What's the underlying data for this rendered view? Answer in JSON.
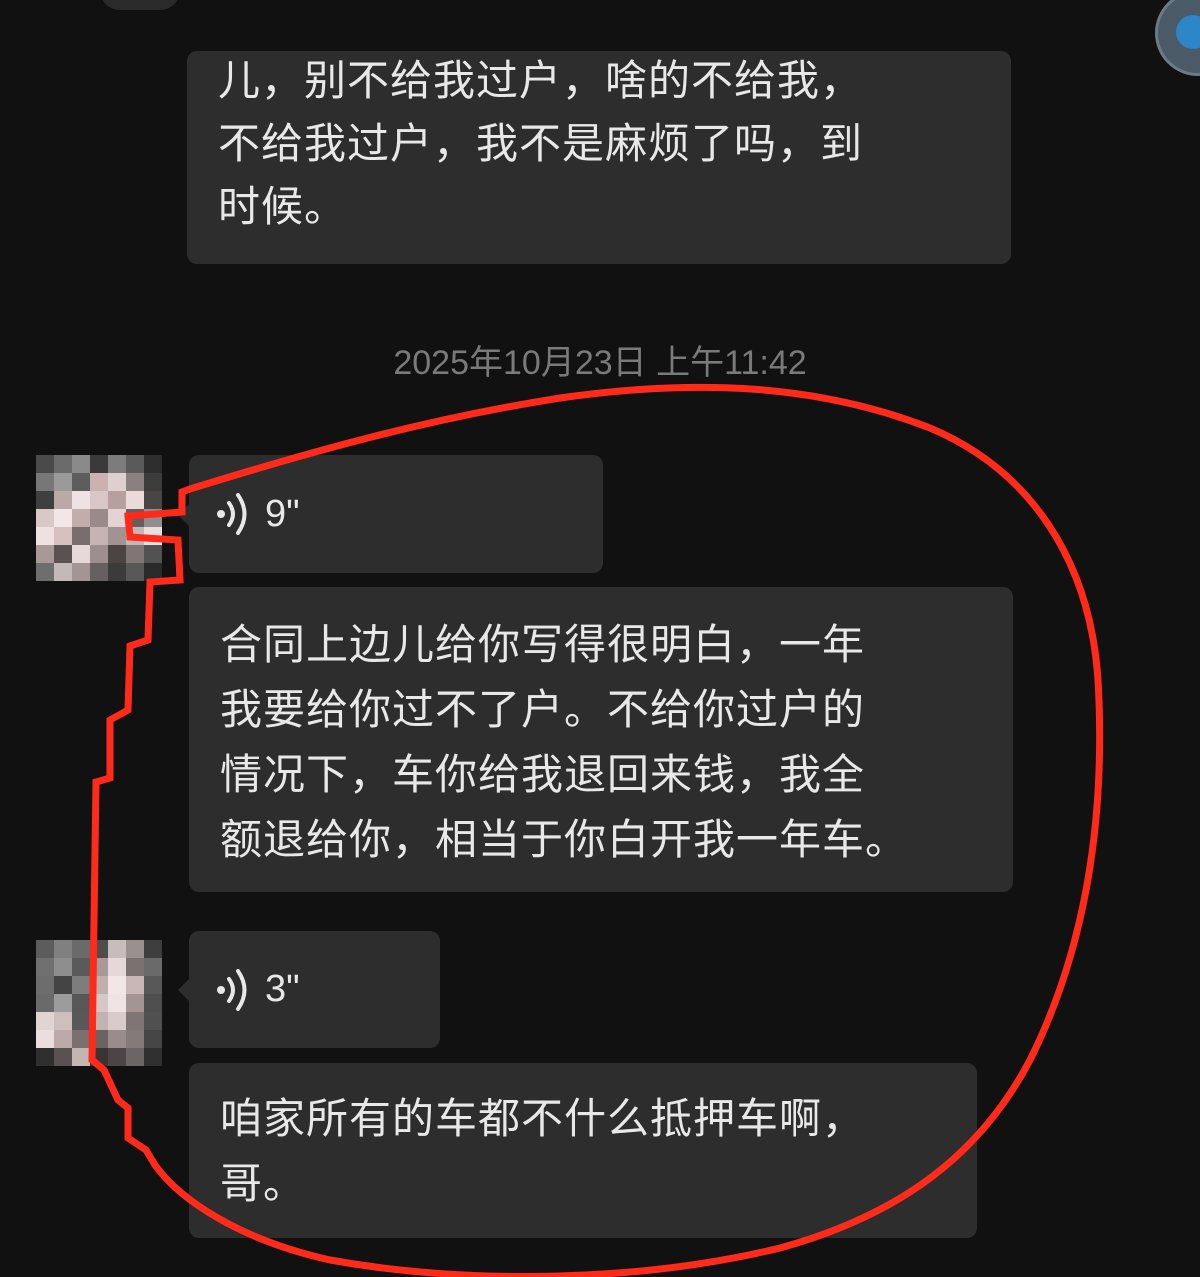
{
  "header": {
    "partial_text": "“ ”"
  },
  "messages": {
    "m1": {
      "text": "儿，别不给我过户，啥的不给我，\n不给我过户，我不是麻烦了吗，到\n时候。"
    },
    "timestamp": "2025年10月23日 上午11:42",
    "m2": {
      "duration": "9\""
    },
    "m3": {
      "text": "合同上边儿给你写得很明白，一年\n我要给你过不了户。不给你过户的\n情况下，车你给我退回来钱，我全\n额退给你，相当于你白开我一年车。"
    },
    "m4": {
      "duration": "3\""
    },
    "m5": {
      "text": "咱家所有的车都不什么抵押车啊，\n哥。"
    }
  },
  "colors": {
    "background": "#111111",
    "bubble": "#2d2d2d",
    "text": "#e8e8e8",
    "timestamp": "#7a7a7a",
    "annotation": "#ff2a1a"
  }
}
